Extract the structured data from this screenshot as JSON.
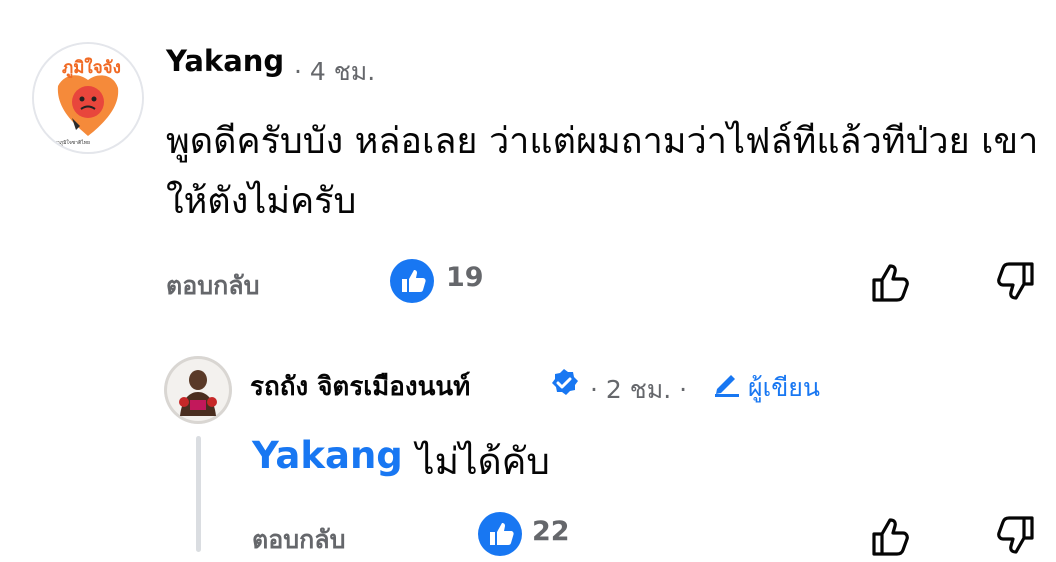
{
  "comment": {
    "author": "Yakang",
    "meta": "· 4 ชม.",
    "avatar": {
      "brand_text": "ภูมิใจจัง",
      "tagline": "รักษาภูมิใจชาติไทย"
    },
    "text": "พูดดีครับบัง หล่อเลย   ว่าแต่ผมถามว่าไฟล์ทีแล้วทีป่วย เขาให้ตังไม่ครับ",
    "reply_label": "ตอบกลับ",
    "like_count": "19"
  },
  "reply": {
    "author": "รถถัง จิตรเมืองนนท์",
    "meta": "· 2 ชม. ·",
    "author_badge": "ผู้เขียน",
    "mention": "Yakang",
    "text": "ไม่ได้คับ",
    "reply_label": "ตอบกลับ",
    "like_count": "22"
  },
  "colors": {
    "accent": "#1877f2",
    "secondary_text": "#65676b",
    "thread_line": "#dadde1",
    "avatar_brand": "#f06a24"
  },
  "icons": [
    "like-reaction-icon",
    "thumbs-up-icon",
    "thumbs-down-icon",
    "verified-badge-icon",
    "pencil-icon"
  ]
}
